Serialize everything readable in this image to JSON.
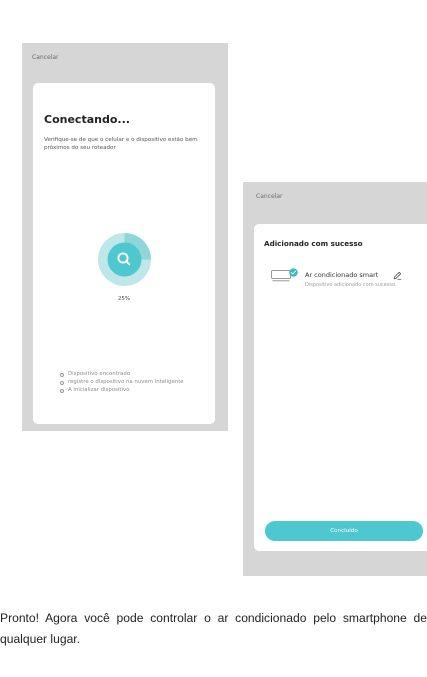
{
  "screen_connecting": {
    "cancel_label": "Cancelar",
    "title": "Conectando...",
    "description": "Verifique-se de que o celular e o dispositivo estão bem próximos do seu roteador",
    "progress_percent": 25,
    "progress_label": "25%",
    "steps": [
      "Dispositivo encontrado",
      "registre o dispositivo na nuvem inteligente",
      "A inicializar dispositivo"
    ]
  },
  "screen_added": {
    "cancel_label": "Cancelar",
    "title": "Adicionado com sucesso",
    "device_name": "Ar condicionado smart",
    "device_status": "Dispositivo adicionado com sucesso.",
    "done_label": "Concluído"
  },
  "caption": "Pronto! Agora você pode controlar o ar condicionado pelo smartphone de qualquer lugar.",
  "colors": {
    "accent": "#4fc7cf",
    "ring_light": "#bfe7ea",
    "ring_mid": "#8fd5dc",
    "phone_bg": "#d6d6d6",
    "check": "#36bdc7"
  },
  "icons": [
    "search-icon",
    "air-conditioner-icon",
    "check-icon",
    "edit-icon"
  ]
}
